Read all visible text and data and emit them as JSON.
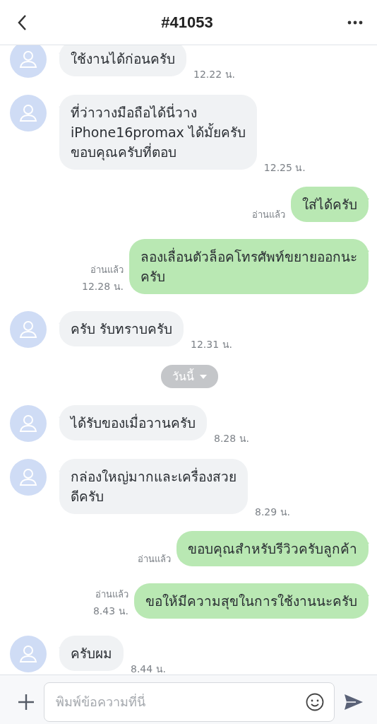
{
  "header": {
    "title": "#41053"
  },
  "messages": [
    {
      "kind": "received",
      "text": "ใช้งานได้ก่อนครับ",
      "time": "12.22 น."
    },
    {
      "kind": "received",
      "text": "ที่ว่าวางมือถือได้นี่วาง\niPhone16promax ได้มั้ยครับ\nขอบคุณครับที่ตอบ",
      "time": "12.25 น."
    },
    {
      "kind": "sent",
      "text": "ใส่ได้ครับ",
      "read": "อ่านแล้ว"
    },
    {
      "kind": "sent",
      "text": "ลองเลื่อนตัวล็อคโทรศัพท์ขยายออกนะ\nครับ",
      "read": "อ่านแล้ว",
      "time": "12.28 น."
    },
    {
      "kind": "received",
      "text": "ครับ รับทราบครับ",
      "time": "12.31 น."
    },
    {
      "kind": "date",
      "text": "วันนี้"
    },
    {
      "kind": "received",
      "text": "ได้รับของเมื่อวานครับ",
      "time": "8.28 น."
    },
    {
      "kind": "received",
      "text": "กล่องใหญ่มากและเครื่องสวย\nดีครับ",
      "time": "8.29 น."
    },
    {
      "kind": "sent",
      "text": "ขอบคุณสำหรับรีวิวครับลูกค้า",
      "read": "อ่านแล้ว"
    },
    {
      "kind": "sent",
      "text": "ขอให้มีความสุขในการใช้งานนะครับ",
      "read": "อ่านแล้ว",
      "time": "8.43 น."
    },
    {
      "kind": "received",
      "text": "ครับผม",
      "time": "8.44 น."
    }
  ],
  "composer": {
    "placeholder": "พิมพ์ข้อความที่นี่"
  }
}
